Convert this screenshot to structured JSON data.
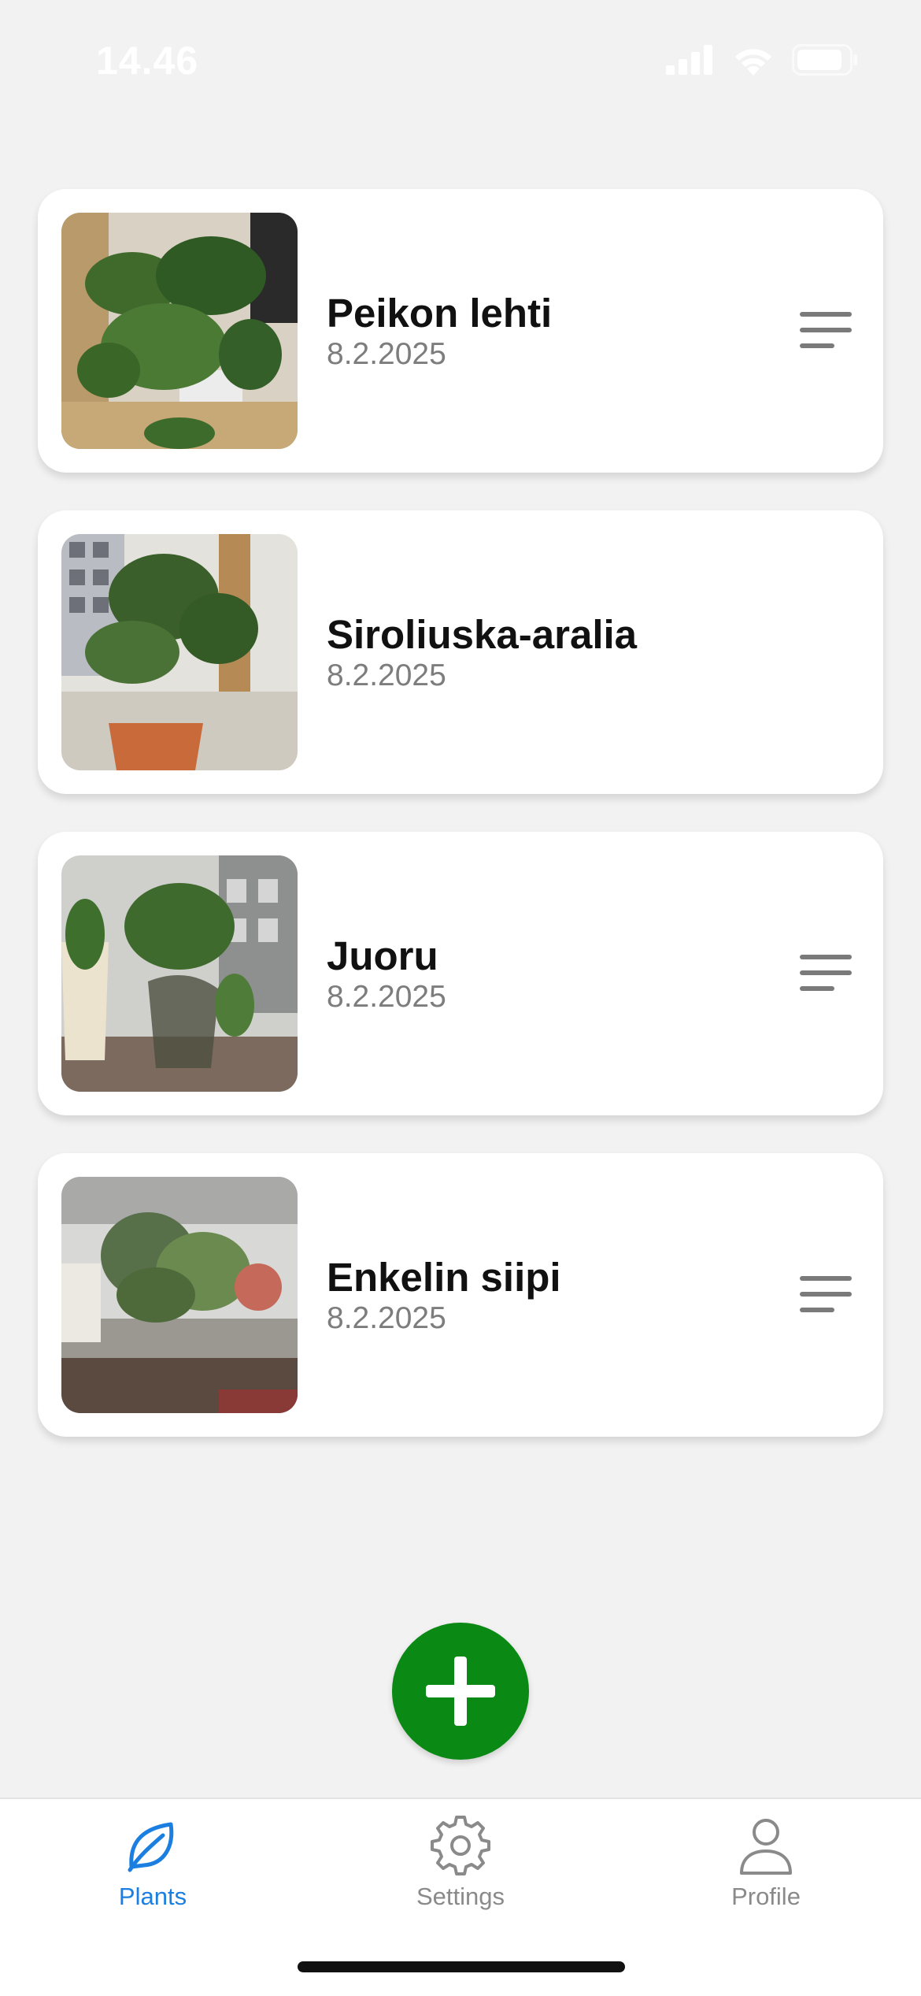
{
  "status_bar": {
    "time": "14.46",
    "icons": [
      "signal-icon",
      "wifi-icon",
      "battery-icon"
    ]
  },
  "plants": [
    {
      "name": "Peikon lehti",
      "date": "8.2.2025",
      "has_menu": true
    },
    {
      "name": "Siroliuska-aralia",
      "date": "8.2.2025",
      "has_menu": false
    },
    {
      "name": "Juoru",
      "date": "8.2.2025",
      "has_menu": true
    },
    {
      "name": "Enkelin siipi",
      "date": "8.2.2025",
      "has_menu": true
    }
  ],
  "fab": {
    "icon": "plus-icon",
    "color": "#0a8a14"
  },
  "tab_bar": {
    "active_color": "#1a7fe0",
    "inactive_color": "#8a8a8a",
    "tabs": [
      {
        "label": "Plants",
        "icon": "leaf-icon",
        "active": true
      },
      {
        "label": "Settings",
        "icon": "gear-icon",
        "active": false
      },
      {
        "label": "Profile",
        "icon": "person-icon",
        "active": false
      }
    ]
  }
}
